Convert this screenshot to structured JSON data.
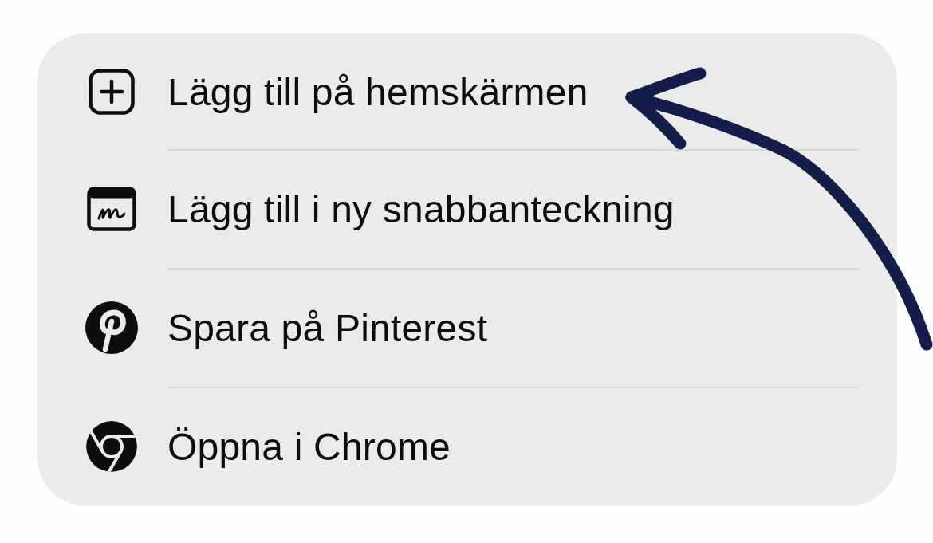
{
  "menu": {
    "items": [
      {
        "label": "Lägg till på hemskärmen"
      },
      {
        "label": "Lägg till i ny snabbanteckning"
      },
      {
        "label": "Spara på Pinterest"
      },
      {
        "label": "Öppna i Chrome"
      }
    ]
  },
  "annotation": {
    "kind": "arrow"
  }
}
